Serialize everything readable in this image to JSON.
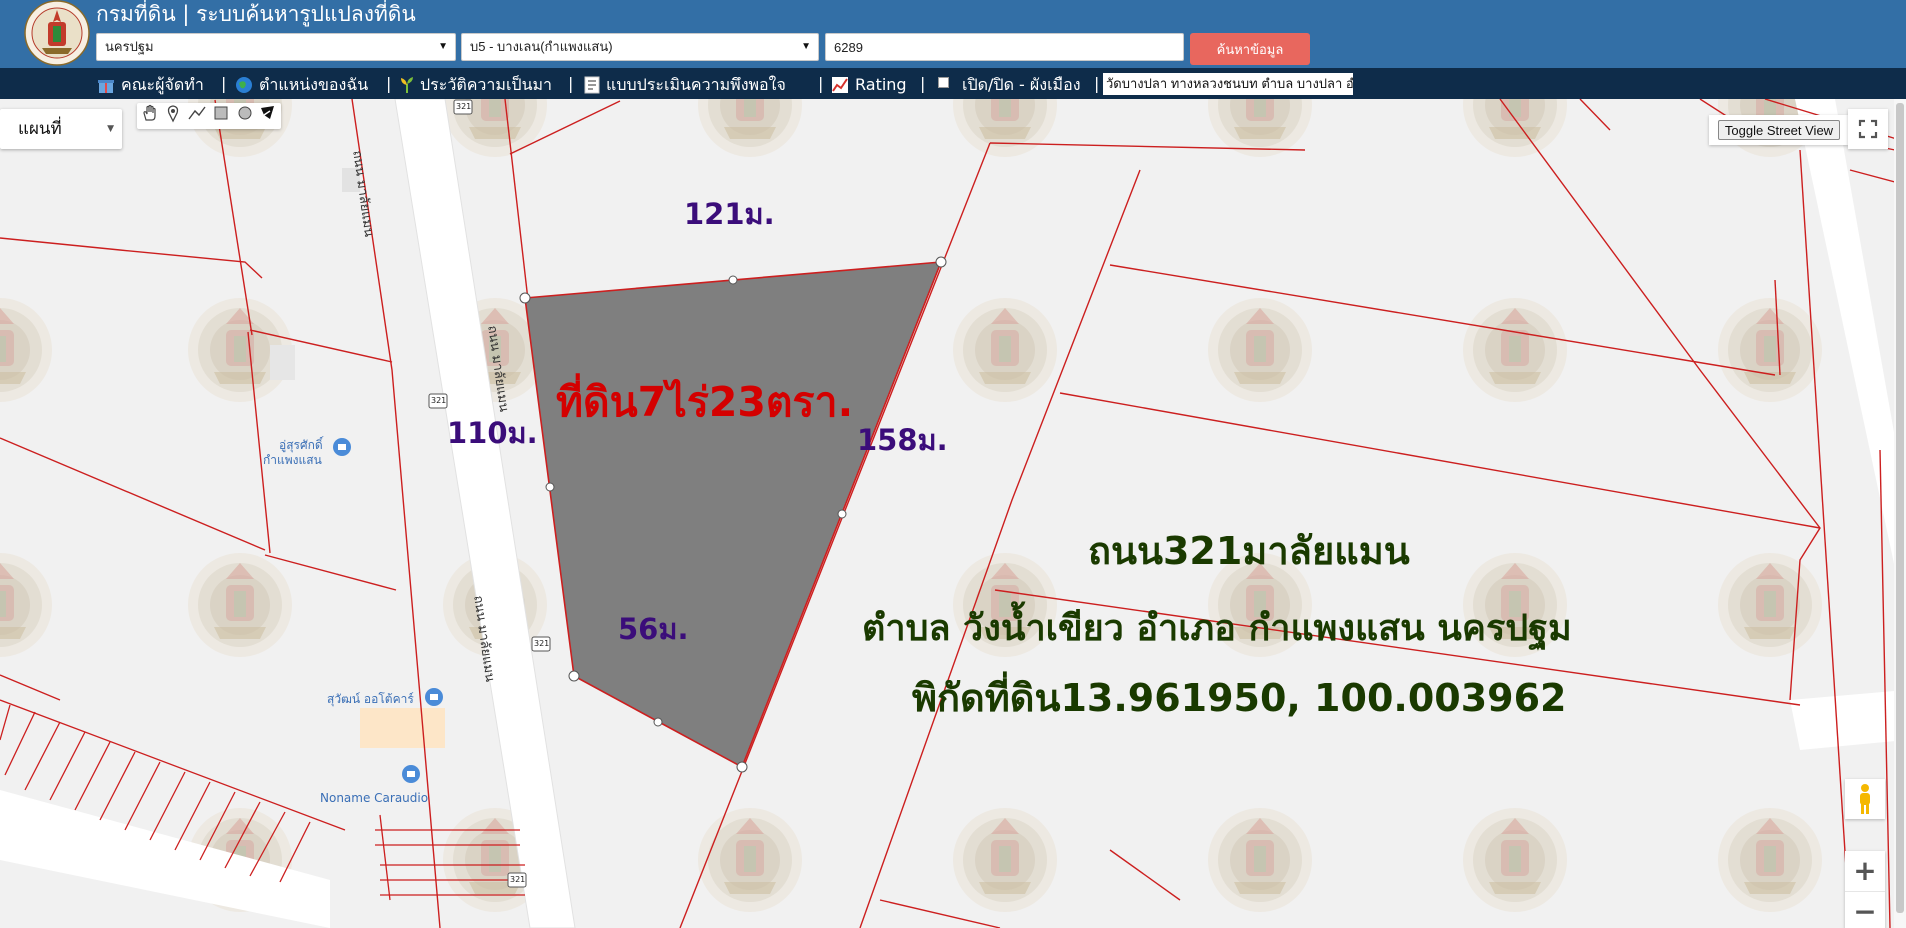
{
  "header": {
    "title": "กรมที่ดิน | ระบบค้นหารูปแปลงที่ดิน",
    "province": {
      "selected": "นครปฐม"
    },
    "district": {
      "selected": "บ5 - บางเลน(กำแพงแสน)"
    },
    "parcel_number": "6289",
    "search_button": "ค้นหาข้อมูล"
  },
  "navbar": {
    "items": [
      {
        "label": "คณะผู้จัดทำ",
        "icon": "gift-icon"
      },
      {
        "label": "ตำแหน่งของฉัน",
        "icon": "globe-icon"
      },
      {
        "label": "ประวัติความเป็นมา",
        "icon": "plant-icon"
      },
      {
        "label": "แบบประเมินความพึงพอใจ",
        "icon": "form-icon"
      },
      {
        "label": "Rating",
        "icon": "chart-icon"
      },
      {
        "label": "เปิด/ปิด - ผังเมือง",
        "icon": "checkbox-icon"
      }
    ],
    "separator": "|",
    "marquee": "วัดบางปลา ทางหลวงชนบท ตำบล บางปลา อำ"
  },
  "map": {
    "map_type": "แผนที่",
    "toggle_street_view": "Toggle Street View",
    "zoom_in": "+",
    "zoom_out": "−",
    "parcel_label": "ที่ดิน7ไร่23ตรา.",
    "dimensions": {
      "top": "121ม.",
      "left": "110ม.",
      "right": "158ม.",
      "bottom": "56ม."
    },
    "info_lines": {
      "road": "ถนน321มาลัยแมน",
      "address": "ตำบล วังน้ำเขียว อำเภอ กำแพงแสน นครปฐม",
      "coordinates": "พิกัดที่ดิน13.961950, 100.003962"
    },
    "road_labels": {
      "malaiman_1": "ถนน มาลัยแมน",
      "malaiman_2": "ถนน มาลัยแมน",
      "malaiman_3": "ถนน มาลัยแมน",
      "route": "321"
    },
    "places": {
      "poi_1": "อู่สุรศักดิ์",
      "poi_1b": "กำแพงแสน",
      "poi_2": "สุวัฒน์ ออโต้คาร์",
      "poi_3": "Noname Caraudio"
    }
  },
  "colors": {
    "header_bg": "#336fa6",
    "navbar_bg": "#0e2c4a",
    "search_button": "#e8675e",
    "parcel_fill": "#7f7f7f",
    "parcel_line": "#cc1f1f",
    "label_red": "#d40000",
    "label_purple": "#3b0d7a",
    "label_green": "#1a3a00"
  }
}
